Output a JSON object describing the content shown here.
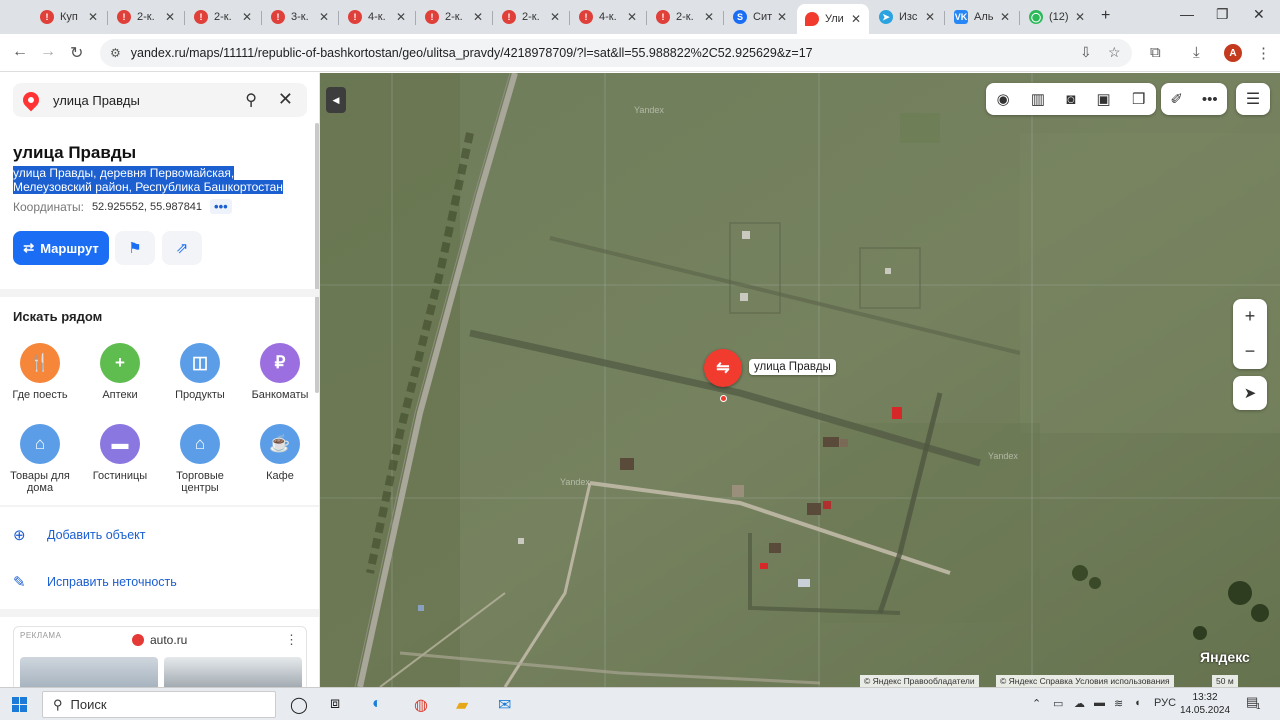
{
  "tabs": [
    {
      "title": "Куп",
      "icon": "notification-icon"
    },
    {
      "title": "2-к.",
      "icon": "notification-icon"
    },
    {
      "title": "2-к.",
      "icon": "notification-icon"
    },
    {
      "title": "3-к.",
      "icon": "notification-icon"
    },
    {
      "title": "4-к.",
      "icon": "notification-icon"
    },
    {
      "title": "2-к.",
      "icon": "notification-icon"
    },
    {
      "title": "2-к.",
      "icon": "notification-icon"
    },
    {
      "title": "4-к.",
      "icon": "notification-icon"
    },
    {
      "title": "2-к.",
      "icon": "notification-icon"
    },
    {
      "title": "Сит",
      "icon": "site-icon"
    },
    {
      "title": "Ули",
      "icon": "maps-pin-icon",
      "active": true
    },
    {
      "title": "Изс",
      "icon": "telegram-icon"
    },
    {
      "title": "Аль",
      "icon": "vk-icon"
    },
    {
      "title": "(12)",
      "icon": "chat-icon"
    }
  ],
  "address_bar": {
    "url": "yandex.ru/maps/11111/republic-of-bashkortostan/geo/ulitsa_pravdy/4218978709/?l=sat&ll=55.988822%2C52.925629&z=17",
    "profile_letter": "A"
  },
  "sidebar": {
    "search_value": "улица Правды",
    "title": "улица Правды",
    "address": "улица Правды, деревня Первомайская, Мелеузовский район, Республика Башкортостан",
    "coords_label": "Координаты:",
    "coords_value": "52.925552, 55.987841",
    "coords_more": "•••",
    "route_button": "Маршрут",
    "nearby_title": "Искать рядом",
    "categories": [
      {
        "label": "Где поесть",
        "icon": "fork-knife-icon",
        "color": "#f5863a"
      },
      {
        "label": "Аптеки",
        "icon": "plus-icon",
        "color": "#5fbd4f"
      },
      {
        "label": "Продукты",
        "icon": "basket-icon",
        "color": "#5c9de8"
      },
      {
        "label": "Банкоматы",
        "icon": "ruble-icon",
        "color": "#9b6fe0"
      },
      {
        "label": "Товары для дома",
        "icon": "bag-icon",
        "color": "#5c9de8"
      },
      {
        "label": "Гостиницы",
        "icon": "bed-icon",
        "color": "#8a77e0"
      },
      {
        "label": "Торговые центры",
        "icon": "bag-icon",
        "color": "#5c9de8"
      },
      {
        "label": "Кафе",
        "icon": "cup-icon",
        "color": "#5c9de8"
      }
    ],
    "actions": [
      {
        "label": "Добавить объект",
        "icon": "add-location-icon"
      },
      {
        "label": "Исправить неточность",
        "icon": "pencil-icon"
      }
    ],
    "ad": {
      "label": "РЕКЛАМА",
      "brand": "auto.ru"
    }
  },
  "map": {
    "marker_label": "улица Правды",
    "logo": "Яндекс",
    "watermark": "Yandex",
    "copyright_1": "© Яндекс  Правообладатели",
    "copyright_2": "© Яндекс  Справка  Условия использования",
    "scale": "50 м",
    "zoom_in": "+",
    "zoom_out": "−"
  },
  "taskbar": {
    "search_placeholder": "Поиск",
    "language": "РУС",
    "time": "13:32",
    "date": "14.05.2024",
    "notification_count": "1"
  },
  "colors": {
    "accent": "#1b6ef3",
    "marker": "#f23b2f",
    "selection": "#1b5fd0"
  }
}
